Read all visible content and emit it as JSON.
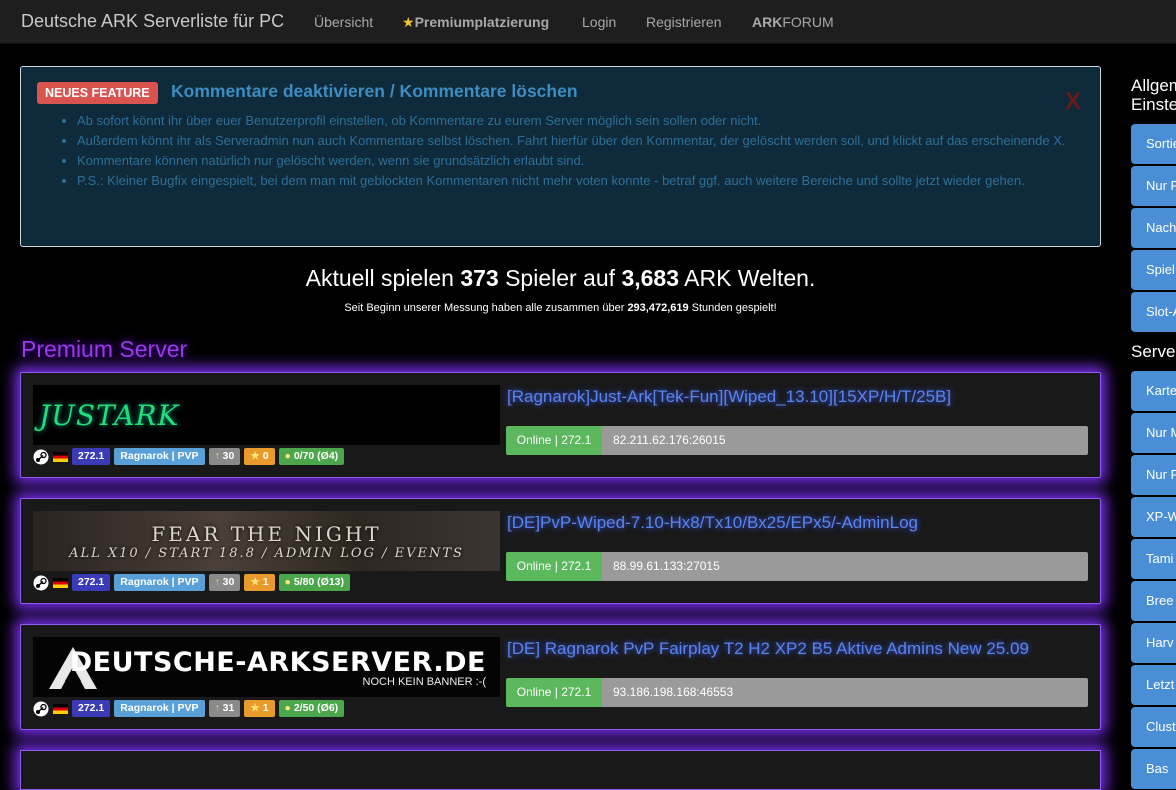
{
  "nav": {
    "brand": "Deutsche ARK Serverliste für PC",
    "overview": "Übersicht",
    "premium_star": "★",
    "premium": "Premiumplatzierung",
    "login": "Login",
    "register": "Registrieren",
    "forum_bold": "ARK",
    "forum_rest": "FORUM"
  },
  "feature": {
    "badge": "NEUES FEATURE",
    "title": "Kommentare deaktivieren / Kommentare löschen",
    "close": "X",
    "items": [
      "Ab sofort könnt ihr über euer Benutzerprofil einstellen, ob Kommentare zu eurem Server möglich sein sollen oder nicht.",
      "Außerdem könnt ihr als Serveradmin nun auch Kommentare selbst löschen. Fahrt hierfür über den Kommentar, der gelöscht werden soll, und klickt auf das erscheinende X.",
      "Kommentare können natürlich nur gelöscht werden, wenn sie grundsätzlich erlaubt sind.",
      "P.S.: Kleiner Bugfix eingespielt, bei dem man mit geblockten Kommentaren nicht mehr voten konnte - betraf ggf. auch weitere Bereiche und sollte jetzt wieder gehen."
    ]
  },
  "stats": {
    "t1": "Aktuell spielen ",
    "players": "373",
    "t2": " Spieler auf ",
    "worlds": "3,683",
    "t3": " ARK Welten.",
    "sub1": "Seit Beginn unserer Messung haben alle zusammen über ",
    "hours": "293,472,619",
    "sub2": " Stunden gespielt!"
  },
  "premium_title": "Premium Server",
  "servers": [
    {
      "banner_l1": "JUSTARK",
      "name": "[Ragnarok]Just-Ark[Tek-Fun][Wiped_13.10][15XP/H/T/25B]",
      "online": "Online | 272.1",
      "ip": "82.211.62.176:26015",
      "version": "272.1",
      "map": "Ragnarok | PVP",
      "votes": "30",
      "stars": "0",
      "players": "0/70 (Ø4)"
    },
    {
      "banner_l1": "FEAR THE NIGHT",
      "banner_l2": "ALL X10 / START 18.8 / ADMIN LOG / EVENTS",
      "name": "[DE]PvP-Wiped-7.10-Hx8/Tx10/Bx25/EPx5/-AdminLog",
      "online": "Online | 272.1",
      "ip": "88.99.61.133:27015",
      "version": "272.1",
      "map": "Ragnarok | PVP",
      "votes": "30",
      "stars": "1",
      "players": "5/80 (Ø13)"
    },
    {
      "banner_l1": "DEUTSCHE-ARKSERVER.DE",
      "banner_l2": "NOCH KEIN BANNER :-(",
      "name": "[DE] Ragnarok PvP Fairplay T2 H2 XP2 B5 Aktive Admins New 25.09",
      "online": "Online | 272.1",
      "ip": "93.186.198.168:46553",
      "version": "272.1",
      "map": "Ragnarok | PVP",
      "votes": "31",
      "stars": "1",
      "players": "2/50 (Ø6)"
    }
  ],
  "sidebar": {
    "heading1_l1": "Allgem",
    "heading1_l2": "Einste",
    "btns1": [
      "Sortie",
      "Nur P",
      "Nach",
      "Spiel",
      "Slot-A"
    ],
    "heading2": "Server",
    "btns2": [
      "Karte",
      "Nur M",
      "Nur P",
      "XP-W",
      "Tami",
      "Bree",
      "Harv",
      "Letzt",
      "Clust",
      "Bas"
    ]
  },
  "colors": {
    "accent_purple": "#9b3ce8",
    "online_green": "#5cb85c",
    "badge_red": "#d9534f",
    "sidebar_blue": "#4a8fd6"
  }
}
